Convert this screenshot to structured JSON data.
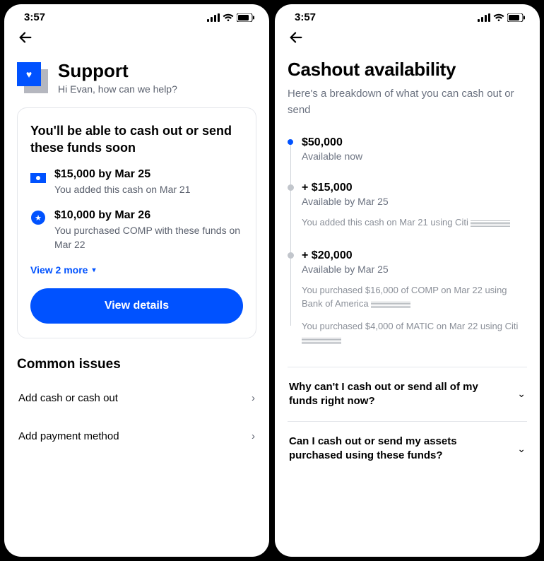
{
  "status_time": "3:57",
  "left": {
    "title": "Support",
    "greeting": "Hi Evan, how can we help?",
    "card_title": "You'll be able to cash out or send these funds soon",
    "funds": [
      {
        "icon": "cash",
        "amount": "$15,000 by Mar 25",
        "desc": "You added this cash on Mar 21"
      },
      {
        "icon": "star",
        "amount": "$10,000 by Mar 26",
        "desc": "You purchased COMP with these funds on Mar 22"
      }
    ],
    "view_more": "View 2 more",
    "view_details": "View details",
    "common_issues_title": "Common issues",
    "issues": [
      "Add cash or cash out",
      "Add payment method"
    ]
  },
  "right": {
    "title": "Cashout availability",
    "subtitle": "Here's a breakdown of what you can cash out or send",
    "items": [
      {
        "active": true,
        "amount": "$50,000",
        "avail": "Available now",
        "notes": []
      },
      {
        "active": false,
        "amount": "+ $15,000",
        "avail": "Available by Mar 25",
        "notes": [
          "You added this cash on Mar 21 using Citi"
        ]
      },
      {
        "active": false,
        "amount": "+ $20,000",
        "avail": "Available by Mar 25",
        "notes": [
          "You purchased $16,000 of COMP on Mar 22  using Bank of America",
          "You purchased $4,000 of MATIC on Mar 22 using Citi"
        ]
      }
    ],
    "faqs": [
      "Why can't I cash out or send all of my funds right now?",
      "Can I cash out or send my assets purchased using these funds?"
    ]
  }
}
